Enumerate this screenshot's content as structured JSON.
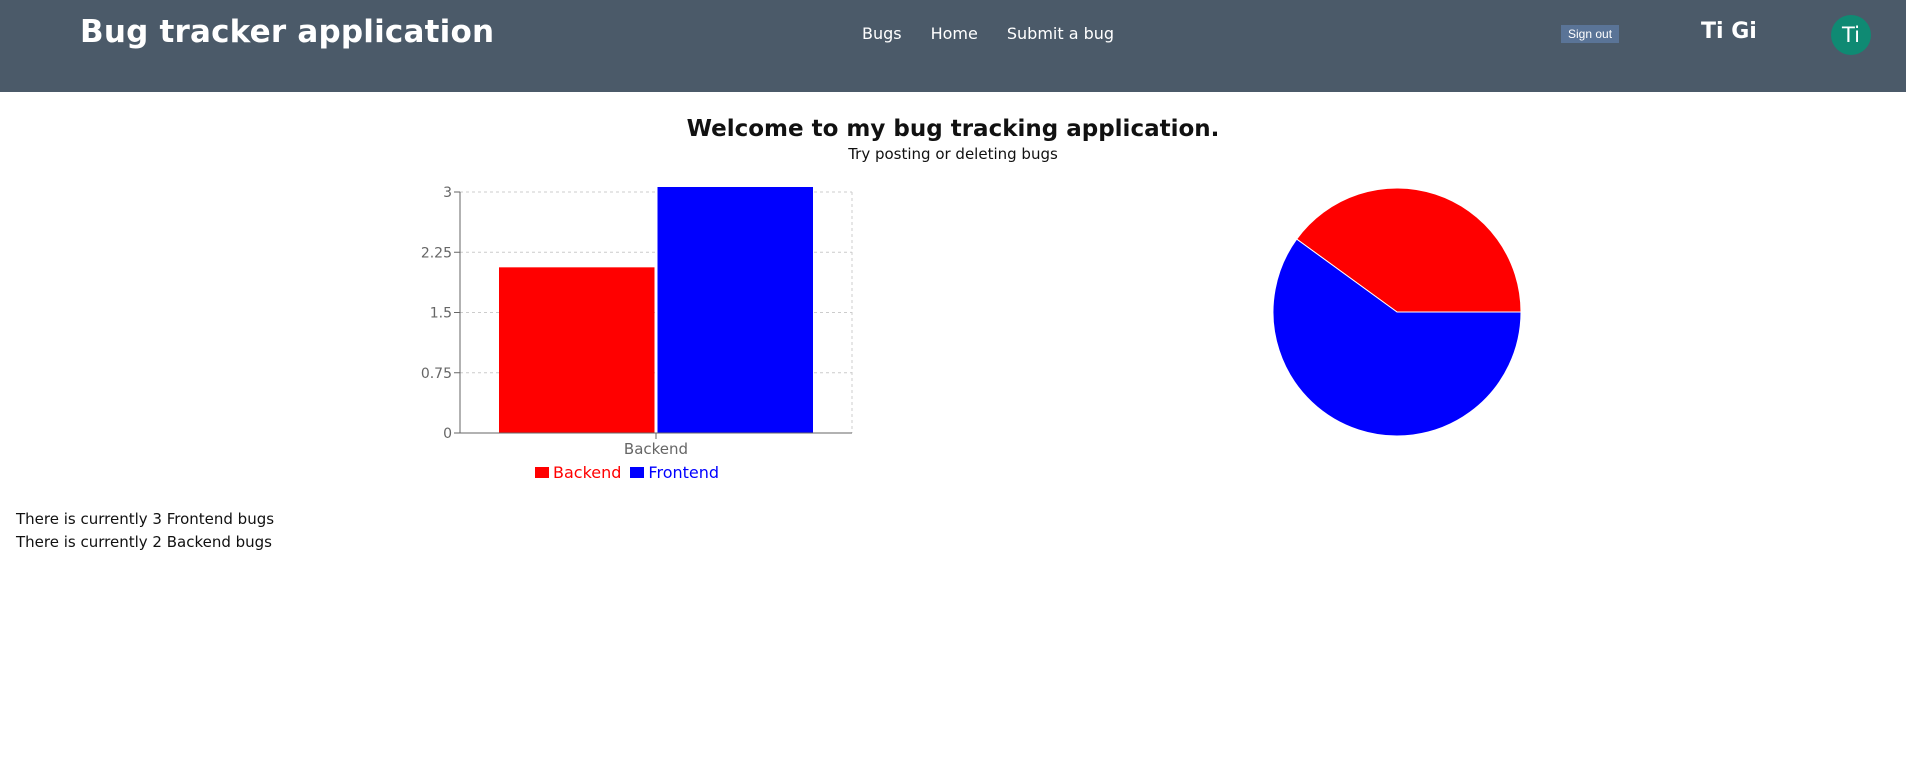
{
  "header": {
    "title": "Bug tracker application",
    "nav": [
      "Bugs",
      "Home",
      "Submit a bug"
    ],
    "sign_out": "Sign out",
    "username": "Ti Gi",
    "avatar_initials": "Ti"
  },
  "main": {
    "welcome": "Welcome to my bug tracking application.",
    "tagline": "Try posting or deleting bugs",
    "frontend_count_text": "There is currently 3 Frontend bugs",
    "backend_count_text": "There is currently 2 Backend bugs"
  },
  "colors": {
    "header_bg": "#4b5a69",
    "backend": "#ff0000",
    "frontend": "#0000ff",
    "avatar": "#0f8a73",
    "sign_out_bg": "#5a7497"
  },
  "chart_data": [
    {
      "type": "bar",
      "categories": [
        "Backend"
      ],
      "series": [
        {
          "name": "Backend",
          "values": [
            2
          ],
          "color": "#ff0000"
        },
        {
          "name": "Frontend",
          "values": [
            3
          ],
          "color": "#0000ff"
        }
      ],
      "yticks": [
        "0",
        "0.75",
        "1.5",
        "2.25",
        "3"
      ],
      "ylim": [
        0,
        3
      ],
      "grid": true,
      "legend": "bottom"
    },
    {
      "type": "pie",
      "slices": [
        {
          "name": "Backend",
          "value": 2,
          "color": "#ff0000"
        },
        {
          "name": "Frontend",
          "value": 3,
          "color": "#0000ff"
        }
      ]
    }
  ]
}
